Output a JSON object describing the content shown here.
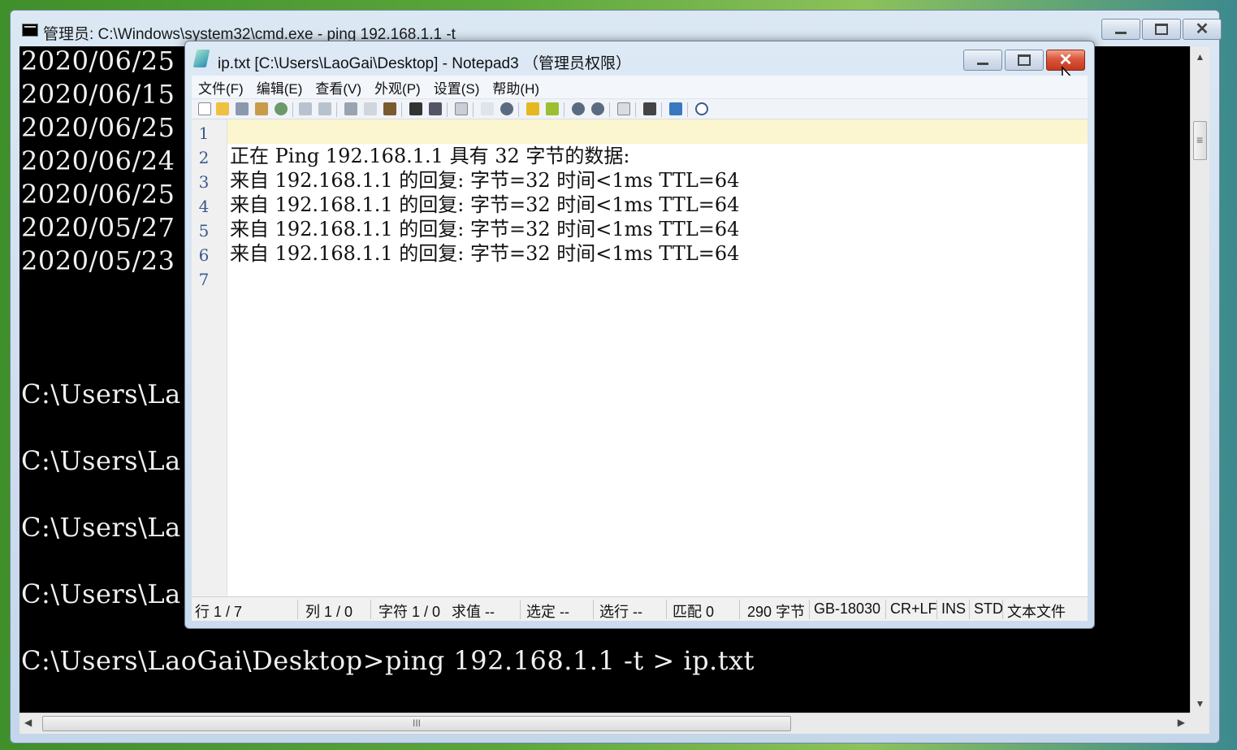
{
  "cmd": {
    "title": "管理员: C:\\Windows\\system32\\cmd.exe - ping  192.168.1.1 -t",
    "lines": [
      "2020/06/25",
      "2020/06/15",
      "2020/06/25",
      "2020/06/24",
      "2020/06/25",
      "2020/05/27",
      "2020/05/23",
      "C:\\Users\\La",
      "C:\\Users\\La",
      "C:\\Users\\La",
      "C:\\Users\\La",
      "C:\\Users\\LaoGai\\Desktop>ping 192.168.1.1 -t > ip.txt"
    ],
    "hscroll_grip": "III"
  },
  "notepad": {
    "title": "ip.txt [C:\\Users\\LaoGai\\Desktop] - Notepad3 （管理员权限）",
    "menu": [
      "文件(F)",
      "编辑(E)",
      "查看(V)",
      "外观(P)",
      "设置(S)",
      "帮助(H)"
    ],
    "line_numbers": [
      "1",
      "2",
      "3",
      "4",
      "5",
      "6",
      "7"
    ],
    "lines": [
      "",
      "正在 Ping 192.168.1.1 具有 32 字节的数据:",
      "来自 192.168.1.1 的回复: 字节=32 时间<1ms TTL=64",
      "来自 192.168.1.1 的回复: 字节=32 时间<1ms TTL=64",
      "来自 192.168.1.1 的回复: 字节=32 时间<1ms TTL=64",
      "来自 192.168.1.1 的回复: 字节=32 时间<1ms TTL=64",
      ""
    ],
    "status": {
      "line": "行  1 / 7",
      "column": "列  1 / 0",
      "chars": "字符  1 / 0",
      "value": "求值  --",
      "selection": "选定  --",
      "sel_lines": "选行  --",
      "matches": "匹配  0",
      "size": "290 字节",
      "encoding": "GB-18030",
      "eol": "CR+LF",
      "ins": "INS",
      "std": "STD",
      "filetype": "文本文件"
    },
    "toolbar_icons": [
      "new-file-icon",
      "open-file-icon",
      "save-icon",
      "save-as-icon",
      "revert-icon",
      "undo-icon",
      "redo-icon",
      "cut-icon",
      "copy-icon",
      "paste-icon",
      "find-icon",
      "replace-icon",
      "wordwrap-icon",
      "select-all-icon",
      "search-next-icon",
      "favorite-icon",
      "add-favorite-icon",
      "zoom-in-icon",
      "zoom-out-icon",
      "schema-icon",
      "screen-icon",
      "pin-icon",
      "exit-icon"
    ]
  },
  "colors": {
    "console_bg": "#000000",
    "console_fg": "#f0f0f0",
    "current_line": "#fbf6cf",
    "close_red": "#c3381f"
  }
}
